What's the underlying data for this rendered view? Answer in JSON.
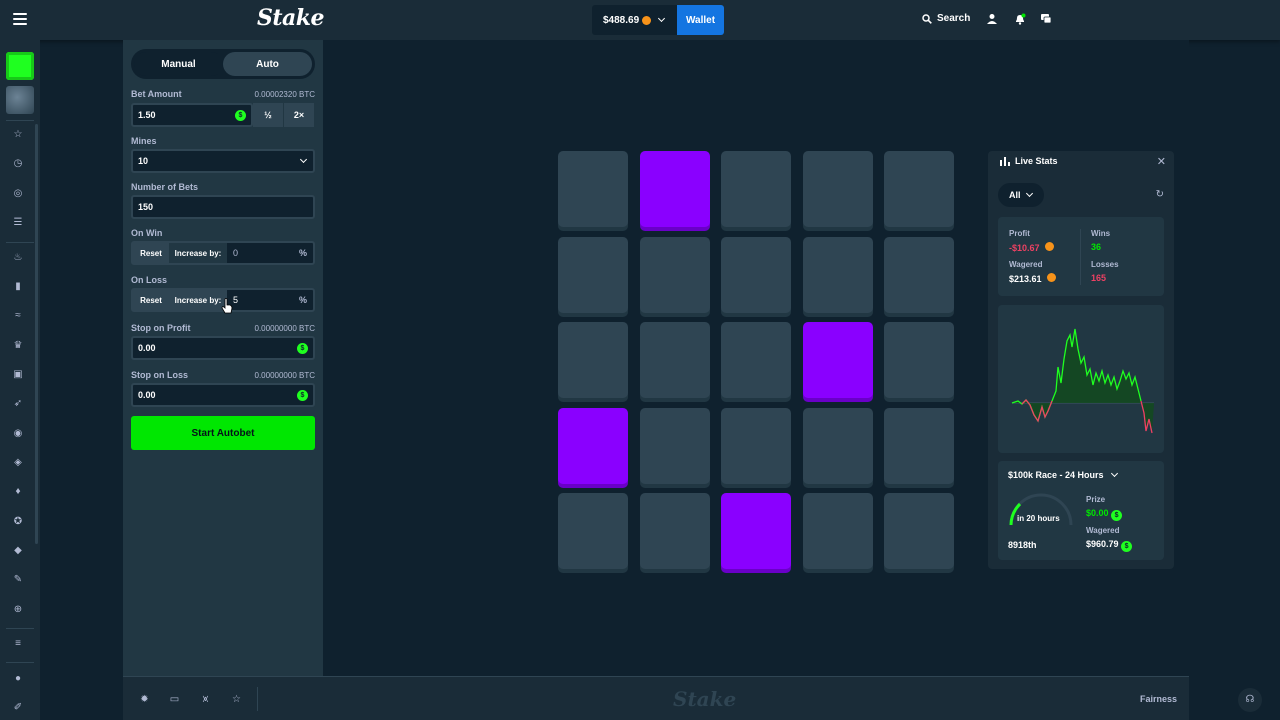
{
  "topbar": {
    "logo": "Stake",
    "balance": "$488.69",
    "wallet_label": "Wallet",
    "search_label": "Search"
  },
  "controls": {
    "tabs": [
      {
        "label": "Manual"
      },
      {
        "label": "Auto"
      }
    ],
    "bet_amount": {
      "label": "Bet Amount",
      "btc": "0.00002320 BTC",
      "value": "1.50",
      "half": "½",
      "double": "2×"
    },
    "mines": {
      "label": "Mines",
      "value": "10"
    },
    "number_of_bets": {
      "label": "Number of Bets",
      "value": "150"
    },
    "on_win": {
      "label": "On Win",
      "reset": "Reset",
      "increase": "Increase by:",
      "value": "0",
      "unit": "%"
    },
    "on_loss": {
      "label": "On Loss",
      "reset": "Reset",
      "increase": "Increase by:",
      "value": "5",
      "unit": "%"
    },
    "stop_on_profit": {
      "label": "Stop on Profit",
      "btc": "0.00000000 BTC",
      "value": "0.00"
    },
    "stop_on_loss": {
      "label": "Stop on Loss",
      "btc": "0.00000000 BTC",
      "value": "0.00"
    },
    "start_label": "Start Autobet"
  },
  "grid": {
    "gems": [
      1,
      13,
      15,
      22
    ]
  },
  "footer": {
    "watermark": "Stake",
    "fairness": "Fairness"
  },
  "live_stats": {
    "title": "Live Stats",
    "filter": "All",
    "profit_label": "Profit",
    "profit": "-$10.67",
    "wagered_label": "Wagered",
    "wagered": "$213.61",
    "wins_label": "Wins",
    "wins": "36",
    "losses_label": "Losses",
    "losses": "165",
    "race": {
      "title": "$100k Race - 24 Hours",
      "time_left": "in 20 hours",
      "rank": "8918th",
      "prize_label": "Prize",
      "prize": "$0.00",
      "wagered_label": "Wagered",
      "wagered": "$960.79"
    }
  },
  "colors": {
    "accent_green": "#00e701",
    "gem_purple": "#8a00ff",
    "wallet_blue": "#1475e1",
    "loss_red": "#ed4163"
  }
}
